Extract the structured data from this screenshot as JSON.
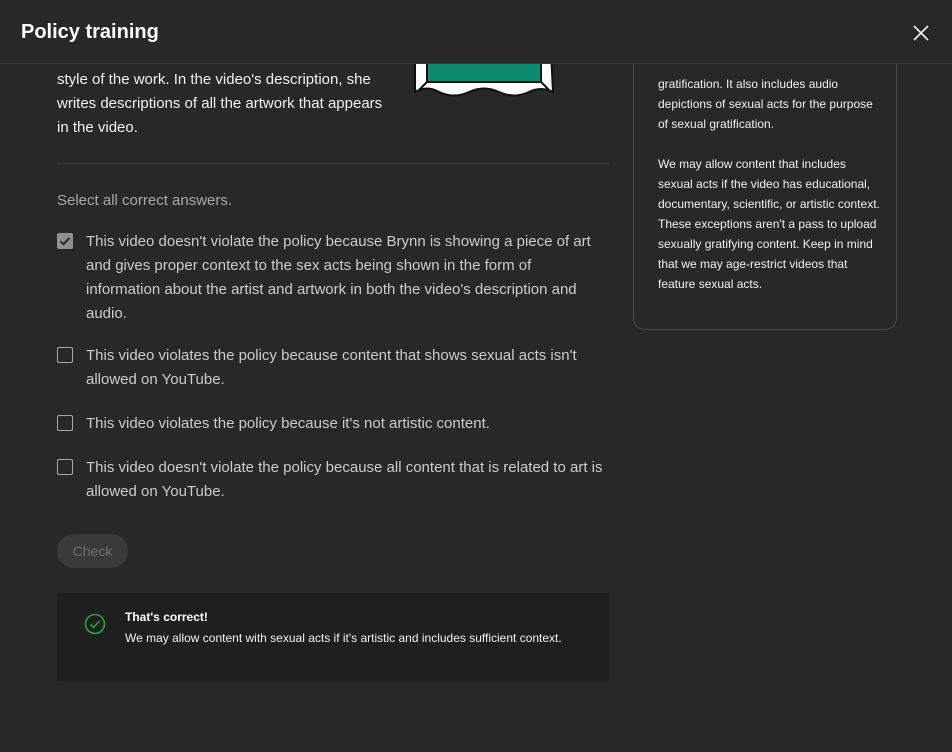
{
  "header": {
    "title": "Policy training",
    "close_icon": "close-icon"
  },
  "scenario": {
    "text": "style of the work. In the video's description, she writes descriptions of all the artwork that appears in the video."
  },
  "question": {
    "instruction": "Select all correct answers.",
    "answers": [
      {
        "label": "This video doesn't violate the policy because Brynn is showing a piece of art and gives proper context to the sex acts being shown in the form of information about the artist and artwork in both the video's description and audio.",
        "checked": true
      },
      {
        "label": "This video violates the policy because content that shows sexual acts isn't allowed on YouTube.",
        "checked": false
      },
      {
        "label": "This video violates the policy because it's not artistic content.",
        "checked": false
      },
      {
        "label": "This video doesn't violate the policy because all content that is related to art is allowed on YouTube.",
        "checked": false
      }
    ],
    "check_label": "Check"
  },
  "feedback": {
    "icon": "check-circle-icon",
    "title": "That's correct!",
    "body": "We may allow content with sexual acts if it's artistic and includes sufficient context."
  },
  "policy_card": {
    "paragraph1": "gratification. It also includes audio depictions of sexual acts for the purpose of sexual gratification.",
    "paragraph2": "We may allow content that includes sexual acts if the video has educational, documentary, scientific, or artistic context. These exceptions aren't a pass to upload sexually gratifying content. Keep in mind that we may age-restrict videos that feature sexual acts."
  },
  "colors": {
    "background": "#282828",
    "feedback_background": "#1f1f1f",
    "success_green": "#2ba640",
    "illustration_green": "#0a8a6e"
  }
}
